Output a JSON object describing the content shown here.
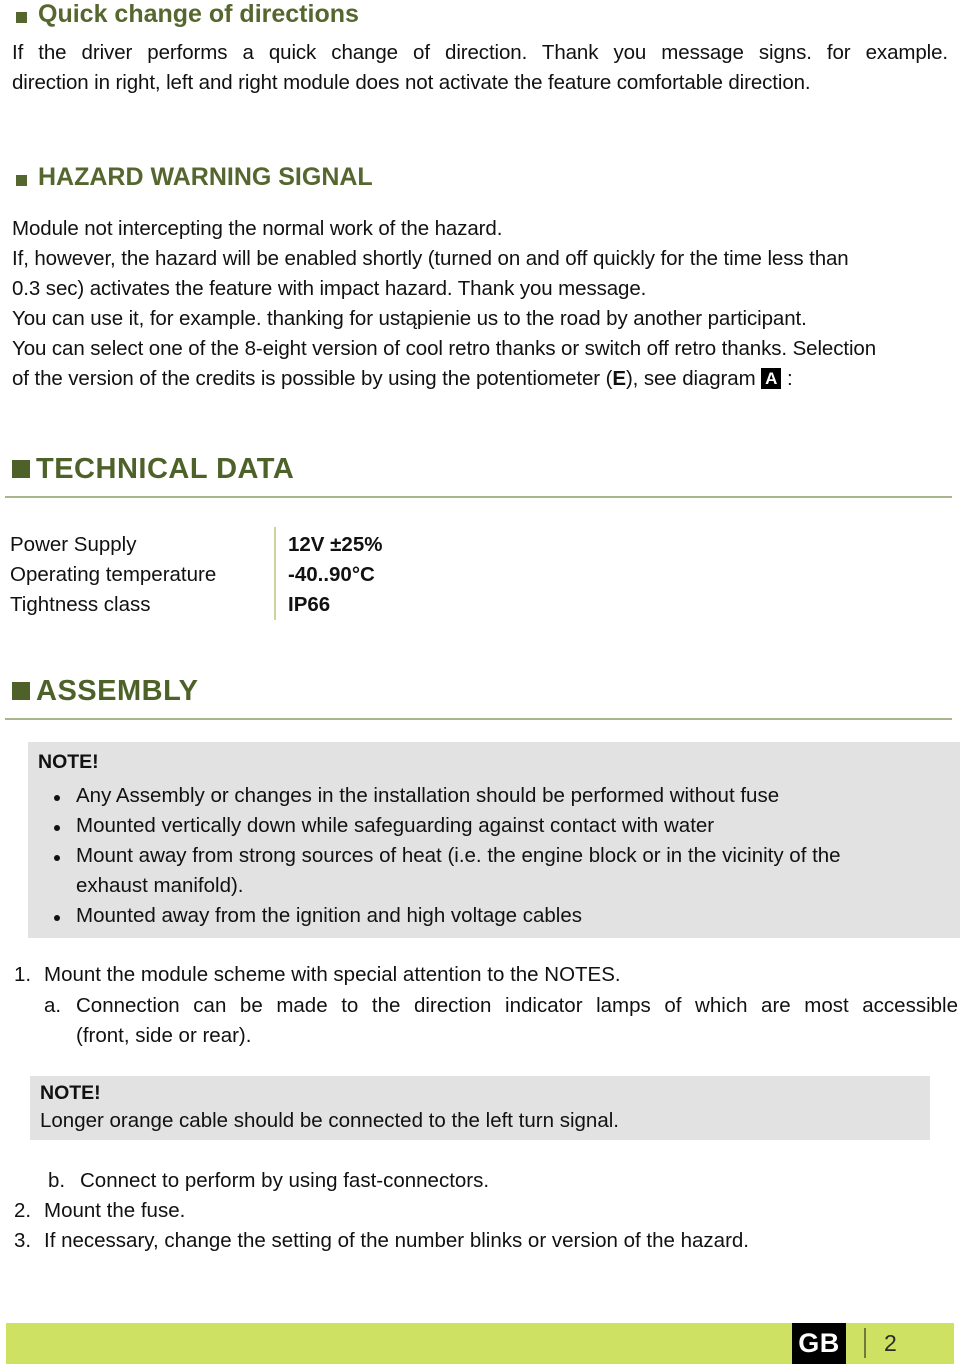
{
  "document": {
    "colors": {
      "heading_green": "#55662E",
      "section_green": "#4D6128",
      "rule_green": "#A8B68B",
      "note_gray": "#E2E2E2",
      "footer_green": "#CFE163",
      "divider_olive": "#CBD49E"
    }
  },
  "section_quick_change": {
    "heading": "Quick change of directions",
    "paragraph_line1": "If the driver performs a quick change of direction. Thank you message signs. for example.",
    "paragraph_line2": "direction in right, left and right module does not activate the feature comfortable direction."
  },
  "section_hazard": {
    "heading": "HAZARD WARNING SIGNAL",
    "line1": "Module not intercepting the normal work of the hazard.",
    "line2": "If, however, the hazard will be enabled shortly (turned on and off quickly for the time less than",
    "line3": "0.3 sec) activates the feature with impact hazard. Thank you message.",
    "line4": "You can use it, for example. thanking for ustąpienie us to the road by another participant.",
    "line5": "You can select one of the 8-eight version of cool retro thanks or switch off retro thanks. Selection",
    "line6_pre": "of the version of the credits is possible by using the potentiometer (",
    "line6_bold": "E",
    "line6_mid": "), see diagram ",
    "line6_box": "A",
    "line6_post": " :"
  },
  "section_technical_data": {
    "heading": "TECHNICAL DATA",
    "rows": [
      {
        "label": "Power Supply",
        "value": "12V ±25%"
      },
      {
        "label": "Operating temperature",
        "value": "-40..90°C"
      },
      {
        "label": "Tightness class",
        "value": "IP66"
      }
    ]
  },
  "section_assembly": {
    "heading": "ASSEMBLY",
    "note1": {
      "title": "NOTE!",
      "bullets": [
        "Any Assembly or changes in the installation should be performed without fuse",
        "Mounted vertically down while safeguarding against contact with water",
        "Mount away from strong sources of heat (i.e. the engine block or in the vicinity of the",
        "exhaust manifold).",
        "Mounted away from the ignition and high voltage cables"
      ]
    },
    "steps": [
      {
        "marker": "1.",
        "text": "Mount the module scheme with special attention to the NOTES."
      },
      {
        "marker": "a.",
        "text_line1": "Connection can be made to the direction indicator lamps of which are most accessible",
        "text_line2": "(front, side or rear)."
      }
    ],
    "note2": {
      "title": "NOTE!",
      "text": "Longer orange cable should be connected to the left turn signal."
    },
    "steps_after": [
      {
        "marker": "b.",
        "text": "Connect to perform by using fast-connectors."
      },
      {
        "marker": "2.",
        "text": "Mount the fuse."
      },
      {
        "marker": "3.",
        "text": "If necessary, change the setting of the number blinks or version of the hazard."
      }
    ]
  },
  "footer": {
    "language": "GB",
    "page_number": "2"
  }
}
